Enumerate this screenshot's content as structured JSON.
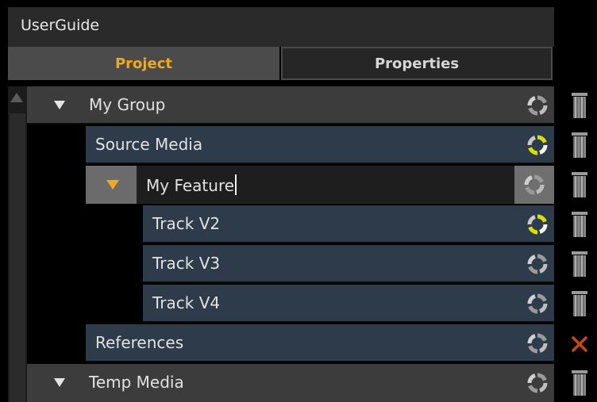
{
  "window": {
    "title": "UserGuide"
  },
  "tabs": [
    {
      "label": "Project",
      "active": true
    },
    {
      "label": "Properties",
      "active": false
    }
  ],
  "tree": [
    {
      "label": "My Group",
      "sync": "idle"
    },
    {
      "label": "Source Media",
      "sync": "active"
    },
    {
      "label": "My Feature",
      "sync": "idle",
      "editing": true
    },
    {
      "label": "Track V2",
      "sync": "active"
    },
    {
      "label": "Track V3",
      "sync": "idle"
    },
    {
      "label": "Track V4",
      "sync": "idle"
    },
    {
      "label": "References",
      "sync": "idle",
      "action": "remove"
    },
    {
      "label": "Temp Media",
      "sync": "idle"
    }
  ],
  "colors": {
    "accent": "#f5a623",
    "sync_active": "#d7e000",
    "row_media": "#2d3b4a",
    "row_group": "#3c3c3c",
    "remove": "#c6471c"
  }
}
